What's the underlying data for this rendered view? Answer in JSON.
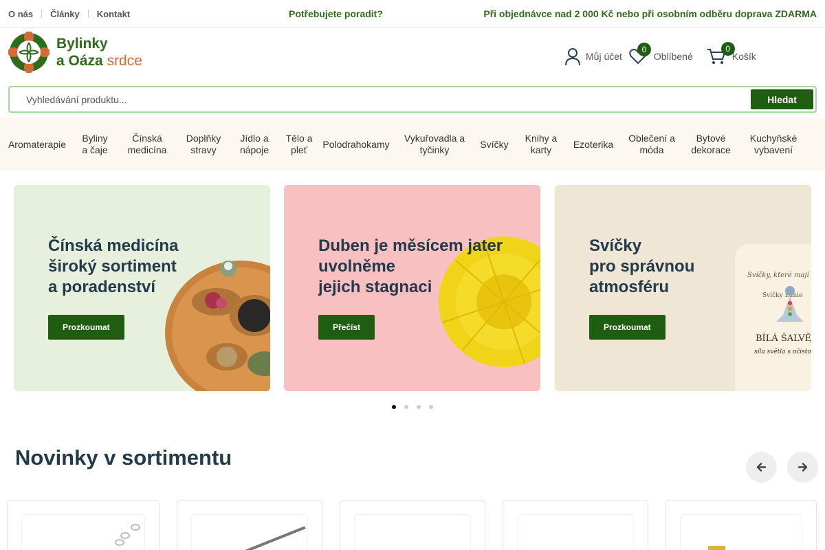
{
  "topbar": {
    "links": [
      "O nás",
      "Články",
      "Kontakt"
    ],
    "advice": "Potřebujete poradit?",
    "shipping": "Při objednávce nad 2 000 Kč nebo při osobním odběru doprava ZDARMA"
  },
  "logo": {
    "line1": "Bylinky",
    "line2a": "a Oáza",
    "line2b": "srdce"
  },
  "header": {
    "account": "Můj účet",
    "favorites": "Oblíbené",
    "favorites_count": "0",
    "cart": "Košík",
    "cart_count": "0"
  },
  "search": {
    "placeholder": "Vyhledávání produktu...",
    "button": "Hledat"
  },
  "nav": [
    "Aromaterapie",
    "Byliny a čaje",
    "Čínská medicína",
    "Doplňky stravy",
    "Jídlo a nápoje",
    "Tělo a pleť",
    "Polodrahokamy",
    "Vykuřovadla a tyčinky",
    "Svíčky",
    "Knihy a karty",
    "Ezoterika",
    "Oblečení a móda",
    "Bytové dekorace",
    "Kuchyňské vybavení"
  ],
  "banners": [
    {
      "title": "Čínská medicína\nširoký sortiment\na poradenství",
      "cta": "Prozkoumat"
    },
    {
      "title": "Duben je měsícem jater\nuvolněme\njejich stagnaci",
      "cta": "Přečíst"
    },
    {
      "title": "Svíčky\npro správnou\natmosféru",
      "cta": "Prozkoumat",
      "candle_text1": "Svíčky, které mají dv",
      "candle_text2": "Svíčky Lunie",
      "candle_text3": "BÍLÁ ŠALVĚJ",
      "candle_text4": "síla světla s očistou"
    }
  ],
  "carousel": {
    "slides": 4,
    "active": 1
  },
  "section": {
    "title": "Novinky v sortimentu"
  },
  "colors": {
    "primary": "#1f5e12",
    "nav_bg": "#fdf8ef",
    "title": "#223a4a"
  }
}
